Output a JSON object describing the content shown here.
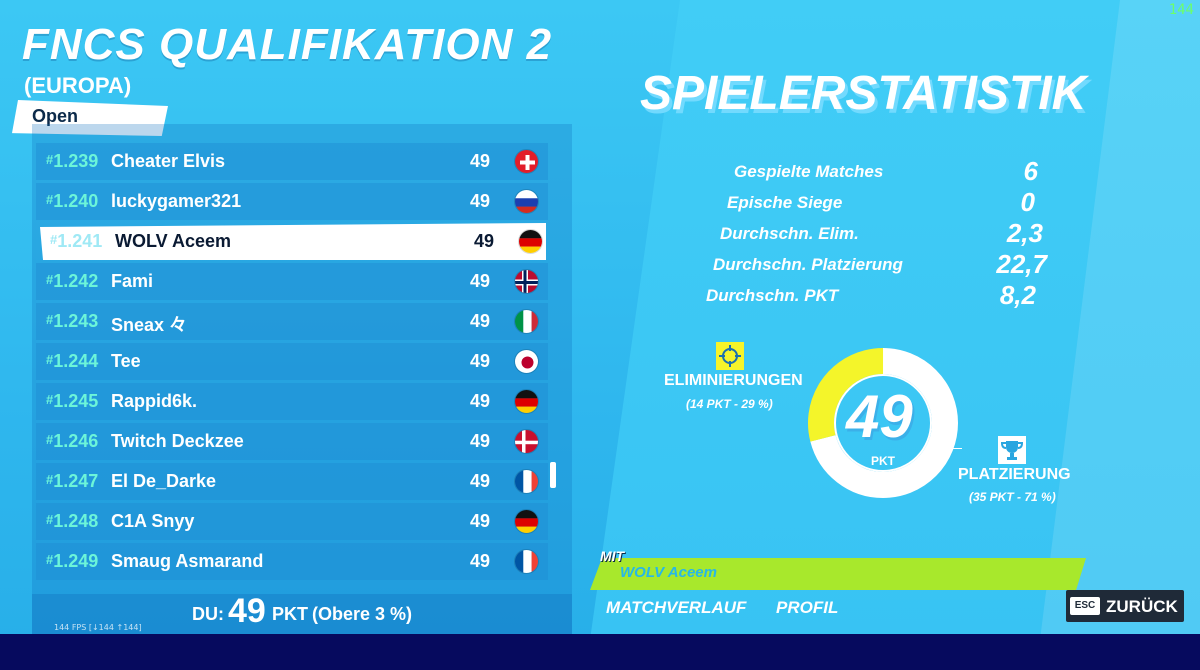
{
  "header": {
    "title": "FNCS QUALIFIKATION 2",
    "subtitle": "(EUROPA)",
    "mode": "Open",
    "fps_corner": "144"
  },
  "leaderboard": {
    "rows": [
      {
        "rank": "1.239",
        "name": "Cheater Elvis",
        "points": "49",
        "flag": "switzerland-flag-icon",
        "highlight": false
      },
      {
        "rank": "1.240",
        "name": "luckygamer321",
        "points": "49",
        "flag": "russia-flag-icon",
        "highlight": false
      },
      {
        "rank": "1.241",
        "name": "WOLV Aceem",
        "points": "49",
        "flag": "germany-flag-icon",
        "highlight": true
      },
      {
        "rank": "1.242",
        "name": "Fami",
        "points": "49",
        "flag": "norway-flag-icon",
        "highlight": false
      },
      {
        "rank": "1.243",
        "name": "Sneax 々",
        "points": "49",
        "flag": "italy-flag-icon",
        "highlight": false
      },
      {
        "rank": "1.244",
        "name": "Tee",
        "points": "49",
        "flag": "japan-flag-icon",
        "highlight": false
      },
      {
        "rank": "1.245",
        "name": "Rappid6k.",
        "points": "49",
        "flag": "germany-flag-icon",
        "highlight": false
      },
      {
        "rank": "1.246",
        "name": "Twitch Deckzee",
        "points": "49",
        "flag": "denmark-flag-icon",
        "highlight": false
      },
      {
        "rank": "1.247",
        "name": "El De_Darke",
        "points": "49",
        "flag": "france-flag-icon",
        "highlight": false
      },
      {
        "rank": "1.248",
        "name": "C1A Snyy",
        "points": "49",
        "flag": "germany-flag-icon",
        "highlight": false
      },
      {
        "rank": "1.249",
        "name": "Smaug Asmarand",
        "points": "49",
        "flag": "france-flag-icon",
        "highlight": false
      }
    ],
    "rank_prefix": "#"
  },
  "summary": {
    "du_label": "DU:",
    "du_value": "49",
    "du_unit": "PKT",
    "du_percentile": "(Obere 3 %)",
    "fps_text": "144 FPS [↓144 ↑144]"
  },
  "stats": {
    "title": "SPIELERSTATISTIK",
    "rows": [
      {
        "label": "Gespielte Matches",
        "value": "6"
      },
      {
        "label": "Epische Siege",
        "value": "0"
      },
      {
        "label": "Durchschn. Elim.",
        "value": "2,3"
      },
      {
        "label": "Durchschn. Platzierung",
        "value": "22,7"
      },
      {
        "label": "Durchschn. PKT",
        "value": "8,2"
      }
    ]
  },
  "donut": {
    "total": "49",
    "unit": "PKT",
    "elim_fraction": 0.29,
    "place_fraction": 0.71,
    "elim_color": "#f4f52a",
    "place_color": "#ffffff",
    "elim_label": "ELIMINIERUNGEN",
    "elim_sub": "(14 PKT - 29 %)",
    "elim_icon": "crosshair-icon",
    "place_label": "PLATZIERUNG",
    "place_sub": "(35 PKT - 71 %)",
    "place_icon": "trophy-icon"
  },
  "team": {
    "mit_label": "MIT",
    "member": "WOLV Aceem",
    "bar_color": "#a8e82c"
  },
  "tabs": {
    "history": "MATCHVERLAUF",
    "profile": "PROFIL"
  },
  "back": {
    "key": "ESC",
    "label": "ZURÜCK"
  }
}
